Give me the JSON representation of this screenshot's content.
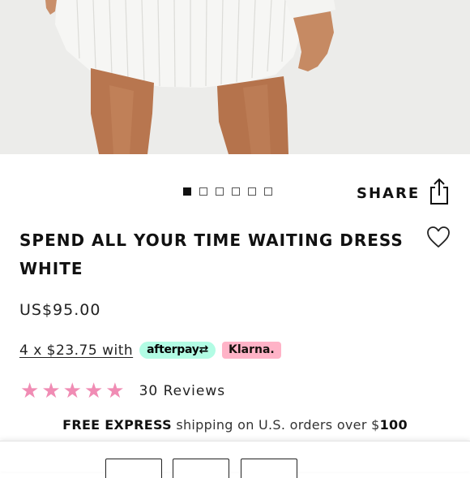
{
  "product": {
    "title": "SPEND ALL YOUR TIME WAITING DRESS WHITE",
    "price": "US$95.00"
  },
  "carousel": {
    "total": 6,
    "active_index": 0
  },
  "share": {
    "label": "SHARE",
    "icon": "share-icon"
  },
  "wishlist": {
    "icon": "heart-icon"
  },
  "installments": {
    "text": "4 x $23.75 with",
    "afterpay": "afterpay",
    "klarna": "Klarna."
  },
  "rating": {
    "stars": 5,
    "reviews": "30 Reviews"
  },
  "shipping": {
    "bold_prefix": "FREE EXPRESS",
    "text": " shipping on U.S. orders over $",
    "amount": "100"
  },
  "colors": {
    "star": "#f08cb4",
    "afterpay_bg": "#b2fce4",
    "klarna_bg": "#ffb3c7"
  }
}
